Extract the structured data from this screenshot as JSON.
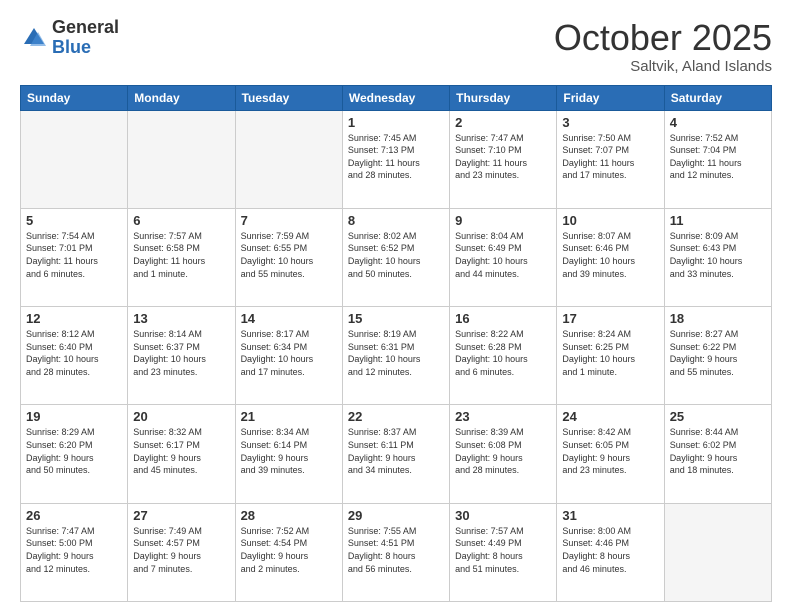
{
  "header": {
    "logo_general": "General",
    "logo_blue": "Blue",
    "month_title": "October 2025",
    "subtitle": "Saltvik, Aland Islands"
  },
  "days_of_week": [
    "Sunday",
    "Monday",
    "Tuesday",
    "Wednesday",
    "Thursday",
    "Friday",
    "Saturday"
  ],
  "weeks": [
    [
      {
        "day": "",
        "lines": []
      },
      {
        "day": "",
        "lines": []
      },
      {
        "day": "",
        "lines": []
      },
      {
        "day": "1",
        "lines": [
          "Sunrise: 7:45 AM",
          "Sunset: 7:13 PM",
          "Daylight: 11 hours",
          "and 28 minutes."
        ]
      },
      {
        "day": "2",
        "lines": [
          "Sunrise: 7:47 AM",
          "Sunset: 7:10 PM",
          "Daylight: 11 hours",
          "and 23 minutes."
        ]
      },
      {
        "day": "3",
        "lines": [
          "Sunrise: 7:50 AM",
          "Sunset: 7:07 PM",
          "Daylight: 11 hours",
          "and 17 minutes."
        ]
      },
      {
        "day": "4",
        "lines": [
          "Sunrise: 7:52 AM",
          "Sunset: 7:04 PM",
          "Daylight: 11 hours",
          "and 12 minutes."
        ]
      }
    ],
    [
      {
        "day": "5",
        "lines": [
          "Sunrise: 7:54 AM",
          "Sunset: 7:01 PM",
          "Daylight: 11 hours",
          "and 6 minutes."
        ]
      },
      {
        "day": "6",
        "lines": [
          "Sunrise: 7:57 AM",
          "Sunset: 6:58 PM",
          "Daylight: 11 hours",
          "and 1 minute."
        ]
      },
      {
        "day": "7",
        "lines": [
          "Sunrise: 7:59 AM",
          "Sunset: 6:55 PM",
          "Daylight: 10 hours",
          "and 55 minutes."
        ]
      },
      {
        "day": "8",
        "lines": [
          "Sunrise: 8:02 AM",
          "Sunset: 6:52 PM",
          "Daylight: 10 hours",
          "and 50 minutes."
        ]
      },
      {
        "day": "9",
        "lines": [
          "Sunrise: 8:04 AM",
          "Sunset: 6:49 PM",
          "Daylight: 10 hours",
          "and 44 minutes."
        ]
      },
      {
        "day": "10",
        "lines": [
          "Sunrise: 8:07 AM",
          "Sunset: 6:46 PM",
          "Daylight: 10 hours",
          "and 39 minutes."
        ]
      },
      {
        "day": "11",
        "lines": [
          "Sunrise: 8:09 AM",
          "Sunset: 6:43 PM",
          "Daylight: 10 hours",
          "and 33 minutes."
        ]
      }
    ],
    [
      {
        "day": "12",
        "lines": [
          "Sunrise: 8:12 AM",
          "Sunset: 6:40 PM",
          "Daylight: 10 hours",
          "and 28 minutes."
        ]
      },
      {
        "day": "13",
        "lines": [
          "Sunrise: 8:14 AM",
          "Sunset: 6:37 PM",
          "Daylight: 10 hours",
          "and 23 minutes."
        ]
      },
      {
        "day": "14",
        "lines": [
          "Sunrise: 8:17 AM",
          "Sunset: 6:34 PM",
          "Daylight: 10 hours",
          "and 17 minutes."
        ]
      },
      {
        "day": "15",
        "lines": [
          "Sunrise: 8:19 AM",
          "Sunset: 6:31 PM",
          "Daylight: 10 hours",
          "and 12 minutes."
        ]
      },
      {
        "day": "16",
        "lines": [
          "Sunrise: 8:22 AM",
          "Sunset: 6:28 PM",
          "Daylight: 10 hours",
          "and 6 minutes."
        ]
      },
      {
        "day": "17",
        "lines": [
          "Sunrise: 8:24 AM",
          "Sunset: 6:25 PM",
          "Daylight: 10 hours",
          "and 1 minute."
        ]
      },
      {
        "day": "18",
        "lines": [
          "Sunrise: 8:27 AM",
          "Sunset: 6:22 PM",
          "Daylight: 9 hours",
          "and 55 minutes."
        ]
      }
    ],
    [
      {
        "day": "19",
        "lines": [
          "Sunrise: 8:29 AM",
          "Sunset: 6:20 PM",
          "Daylight: 9 hours",
          "and 50 minutes."
        ]
      },
      {
        "day": "20",
        "lines": [
          "Sunrise: 8:32 AM",
          "Sunset: 6:17 PM",
          "Daylight: 9 hours",
          "and 45 minutes."
        ]
      },
      {
        "day": "21",
        "lines": [
          "Sunrise: 8:34 AM",
          "Sunset: 6:14 PM",
          "Daylight: 9 hours",
          "and 39 minutes."
        ]
      },
      {
        "day": "22",
        "lines": [
          "Sunrise: 8:37 AM",
          "Sunset: 6:11 PM",
          "Daylight: 9 hours",
          "and 34 minutes."
        ]
      },
      {
        "day": "23",
        "lines": [
          "Sunrise: 8:39 AM",
          "Sunset: 6:08 PM",
          "Daylight: 9 hours",
          "and 28 minutes."
        ]
      },
      {
        "day": "24",
        "lines": [
          "Sunrise: 8:42 AM",
          "Sunset: 6:05 PM",
          "Daylight: 9 hours",
          "and 23 minutes."
        ]
      },
      {
        "day": "25",
        "lines": [
          "Sunrise: 8:44 AM",
          "Sunset: 6:02 PM",
          "Daylight: 9 hours",
          "and 18 minutes."
        ]
      }
    ],
    [
      {
        "day": "26",
        "lines": [
          "Sunrise: 7:47 AM",
          "Sunset: 5:00 PM",
          "Daylight: 9 hours",
          "and 12 minutes."
        ]
      },
      {
        "day": "27",
        "lines": [
          "Sunrise: 7:49 AM",
          "Sunset: 4:57 PM",
          "Daylight: 9 hours",
          "and 7 minutes."
        ]
      },
      {
        "day": "28",
        "lines": [
          "Sunrise: 7:52 AM",
          "Sunset: 4:54 PM",
          "Daylight: 9 hours",
          "and 2 minutes."
        ]
      },
      {
        "day": "29",
        "lines": [
          "Sunrise: 7:55 AM",
          "Sunset: 4:51 PM",
          "Daylight: 8 hours",
          "and 56 minutes."
        ]
      },
      {
        "day": "30",
        "lines": [
          "Sunrise: 7:57 AM",
          "Sunset: 4:49 PM",
          "Daylight: 8 hours",
          "and 51 minutes."
        ]
      },
      {
        "day": "31",
        "lines": [
          "Sunrise: 8:00 AM",
          "Sunset: 4:46 PM",
          "Daylight: 8 hours",
          "and 46 minutes."
        ]
      },
      {
        "day": "",
        "lines": []
      }
    ]
  ]
}
